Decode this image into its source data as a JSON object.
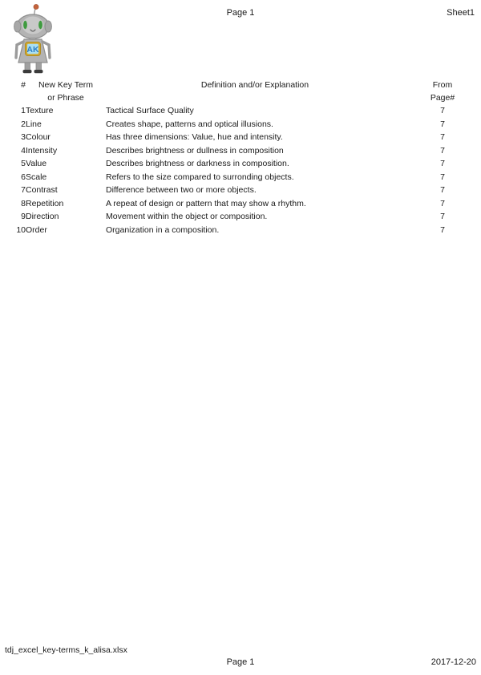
{
  "header": {
    "center": "Page 1",
    "right": "Sheet1"
  },
  "logo": {
    "name": "robot-mascot-logo",
    "badge_text": "AK",
    "colors": {
      "body": "#a9a9a9",
      "body_light": "#c4c4c4",
      "outline": "#8a8a8a",
      "eye": "#3f9b3f",
      "badge_frame": "#d1a830",
      "badge_inner": "#a9dff2",
      "badge_text": "#2f7fc4",
      "antenna_tip": "#c4633c",
      "foot": "#3b3b3b"
    }
  },
  "table": {
    "columns": [
      {
        "key": "num",
        "label": "#",
        "label_line2": ""
      },
      {
        "key": "term",
        "label": "New Key Term",
        "label_line2": "or Phrase"
      },
      {
        "key": "def",
        "label": "Definition and/or Explanation",
        "label_line2": ""
      },
      {
        "key": "page",
        "label": "From",
        "label_line2": "Page#"
      }
    ],
    "rows": [
      {
        "num": "1",
        "term": "Texture",
        "def": "Tactical Surface Quality",
        "page": "7"
      },
      {
        "num": "2",
        "term": "Line",
        "def": "Creates shape, patterns and optical illusions.",
        "page": "7"
      },
      {
        "num": "3",
        "term": "Colour",
        "def": "Has three dimensions: Value, hue and intensity.",
        "page": "7"
      },
      {
        "num": "4",
        "term": "Intensity",
        "def": "Describes brightness or dullness in composition",
        "page": "7"
      },
      {
        "num": "5",
        "term": "Value",
        "def": "Describes brightness or darkness in composition.",
        "page": "7"
      },
      {
        "num": "6",
        "term": "Scale",
        "def": "Refers to the size compared to surronding objects.",
        "page": "7"
      },
      {
        "num": "7",
        "term": "Contrast",
        "def": "Difference between two or more objects.",
        "page": "7"
      },
      {
        "num": "8",
        "term": "Repetition",
        "def": "A repeat of design or pattern that may show a rhythm.",
        "page": "7"
      },
      {
        "num": "9",
        "term": "Direction",
        "def": "Movement within the object or composition.",
        "page": "7"
      },
      {
        "num": "10",
        "term": "Order",
        "def": "Organization in a composition.",
        "page": "7"
      }
    ]
  },
  "footer": {
    "file_name": "tdj_excel_key-terms_k_alisa.xlsx",
    "center": "Page 1",
    "right": "2017-12-20"
  }
}
